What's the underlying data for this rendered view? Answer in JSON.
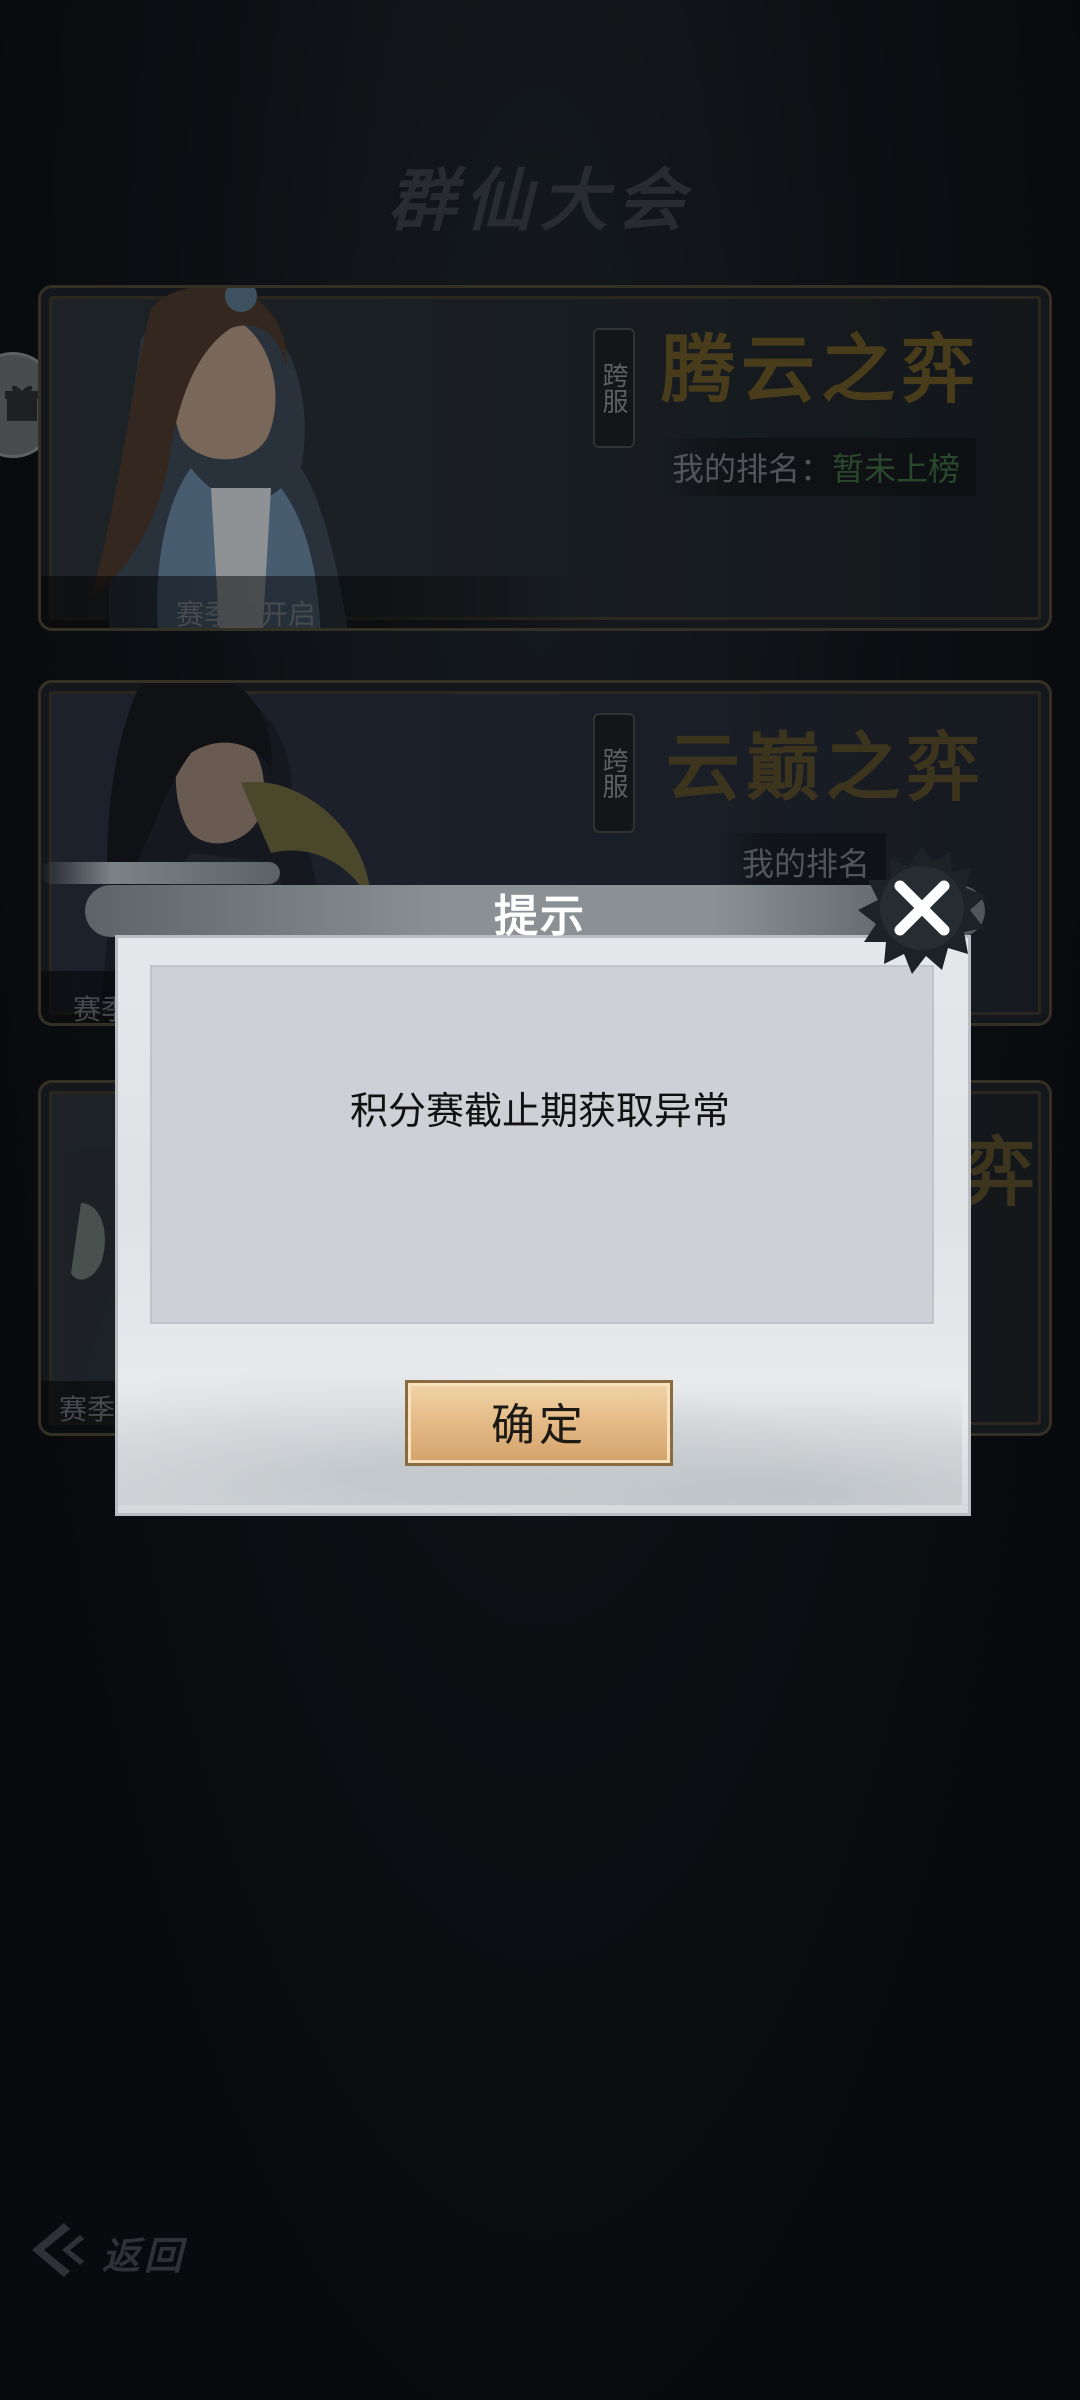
{
  "page": {
    "title": "群仙大会",
    "back_label": "返回"
  },
  "events": [
    {
      "tag": "跨服",
      "title": "腾云之弈",
      "title_color": "#6e5a24",
      "rank_label": "我的排名：",
      "rank_value": "暂未上榜",
      "season_status": "赛季未开启"
    },
    {
      "tag": "跨服",
      "title": "云巅之弈",
      "title_color": "#5b4e28",
      "rank_label": "我的排名",
      "rank_value": "",
      "season_status": "赛季"
    },
    {
      "tag": "",
      "title": "弈",
      "title_color": "#5b4e28",
      "rank_label": "",
      "rank_value": "",
      "season_status": "赛季"
    }
  ],
  "dialog": {
    "title": "提示",
    "message": "积分赛截止期获取异常",
    "confirm_label": "确定",
    "close_icon": "close-icon"
  }
}
